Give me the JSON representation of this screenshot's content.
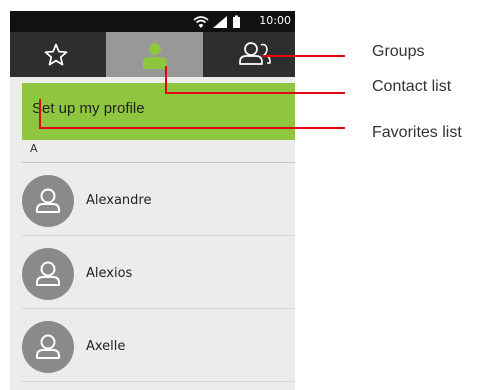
{
  "status_bar": {
    "time": "10:00",
    "icons": [
      "wifi-icon",
      "signal-icon",
      "battery-icon"
    ]
  },
  "tabs": [
    {
      "id": "favorites",
      "icon": "star-icon",
      "selected": false
    },
    {
      "id": "contacts",
      "icon": "person-icon",
      "selected": true
    },
    {
      "id": "groups",
      "icon": "group-icon",
      "selected": false
    }
  ],
  "profile_banner": {
    "label": "Set up my profile"
  },
  "section": {
    "letter": "A"
  },
  "contacts": [
    {
      "name": "Alexandre"
    },
    {
      "name": "Alexios"
    },
    {
      "name": "Axelle"
    }
  ],
  "callouts": {
    "groups": "Groups",
    "contact_list": "Contact list",
    "favorites_list": "Favorites list"
  },
  "colors": {
    "status_bar": "#111111",
    "tab_bar": "#2e2e2e",
    "tab_selected": "#989898",
    "accent_green": "#8fc63f",
    "callout_line": "#e30613",
    "avatar": "#8a8a8a",
    "background": "#ececec"
  }
}
